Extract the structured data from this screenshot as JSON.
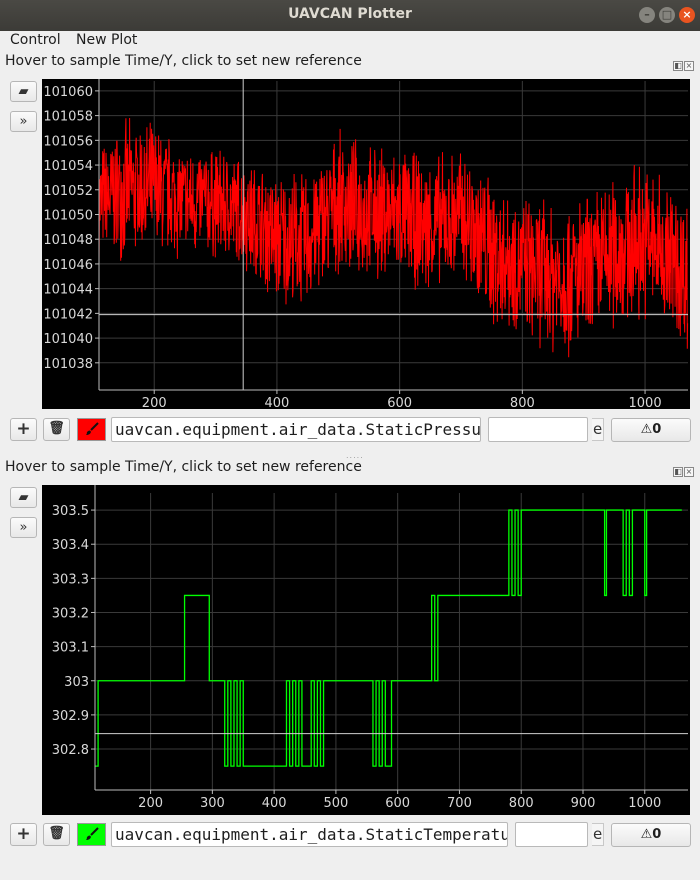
{
  "window": {
    "title": "UAVCAN Plotter"
  },
  "menu": {
    "items": [
      "Control",
      "New Plot"
    ]
  },
  "plots": [
    {
      "header": "Hover to sample Time/Y, click to set new reference",
      "topic": "uavcan.equipment.air_data.StaticPressure",
      "expression_value": "",
      "expression_tail": "e",
      "warning_count": "0",
      "color": "#ff0000",
      "crosshair": {
        "x": 345,
        "y": 101041.9
      }
    },
    {
      "header": "Hover to sample Time/Y, click to set new reference",
      "topic": "uavcan.equipment.air_data.StaticTemperature",
      "expression_value": "",
      "expression_tail": "e",
      "warning_count": "0",
      "color": "#00ff00",
      "crosshair": {
        "y": 302.845
      }
    }
  ],
  "chart_data": [
    {
      "type": "line",
      "series": [
        {
          "name": "uavcan.equipment.air_data.StaticPressure",
          "color": "#ff0000",
          "x": [
            110,
            150,
            200,
            250,
            300,
            350,
            400,
            450,
            500,
            550,
            600,
            650,
            700,
            750,
            800,
            850,
            900,
            950,
            1000,
            1050,
            1070
          ],
          "center": [
            101051,
            101052,
            101052,
            101051,
            101051,
            101050,
            101048,
            101048,
            101051,
            101050,
            101050,
            101049,
            101050,
            101047,
            101046,
            101045,
            101045,
            101047,
            101048,
            101046,
            101045
          ],
          "spread": [
            5,
            6,
            6,
            5,
            5,
            5,
            6,
            6,
            6,
            6,
            6,
            6,
            6,
            7,
            6,
            7,
            7,
            7,
            7,
            7,
            7
          ]
        }
      ],
      "xlim": [
        110,
        1070
      ],
      "ylim": [
        101035.8,
        101060.8
      ],
      "xticks": [
        200,
        400,
        600,
        800,
        1000
      ],
      "yticks": [
        101038,
        101040,
        101042,
        101044,
        101046,
        101048,
        101050,
        101052,
        101054,
        101056,
        101058,
        101060
      ],
      "grid": true
    },
    {
      "type": "line",
      "series": [
        {
          "name": "uavcan.equipment.air_data.StaticTemperature",
          "color": "#00ff00",
          "steps": [
            [
              110,
              302.75
            ],
            [
              115,
              303.0
            ],
            [
              255,
              303.25
            ],
            [
              295,
              303.0
            ],
            [
              320,
              302.75
            ],
            [
              325,
              303.0
            ],
            [
              330,
              302.75
            ],
            [
              335,
              303.0
            ],
            [
              340,
              302.75
            ],
            [
              345,
              303.0
            ],
            [
              350,
              302.75
            ],
            [
              420,
              303.0
            ],
            [
              425,
              302.75
            ],
            [
              430,
              303.0
            ],
            [
              435,
              302.75
            ],
            [
              440,
              303.0
            ],
            [
              445,
              302.75
            ],
            [
              460,
              303.0
            ],
            [
              465,
              302.75
            ],
            [
              470,
              303.0
            ],
            [
              475,
              302.75
            ],
            [
              480,
              303.0
            ],
            [
              560,
              302.75
            ],
            [
              565,
              303.0
            ],
            [
              570,
              302.75
            ],
            [
              575,
              303.0
            ],
            [
              580,
              302.75
            ],
            [
              590,
              303.0
            ],
            [
              655,
              303.25
            ],
            [
              660,
              303.0
            ],
            [
              665,
              303.25
            ],
            [
              780,
              303.5
            ],
            [
              785,
              303.25
            ],
            [
              790,
              303.5
            ],
            [
              795,
              303.25
            ],
            [
              800,
              303.5
            ],
            [
              935,
              303.25
            ],
            [
              938,
              303.5
            ],
            [
              965,
              303.25
            ],
            [
              970,
              303.5
            ],
            [
              975,
              303.25
            ],
            [
              980,
              303.5
            ],
            [
              1000,
              303.25
            ],
            [
              1003,
              303.5
            ],
            [
              1060,
              303.5
            ]
          ]
        }
      ],
      "xlim": [
        110,
        1070
      ],
      "ylim": [
        302.68,
        303.55
      ],
      "xticks": [
        200,
        300,
        400,
        500,
        600,
        700,
        800,
        900,
        1000
      ],
      "yticks": [
        302.8,
        302.9,
        303,
        303.1,
        303.2,
        303.3,
        303.4,
        303.5
      ],
      "ytick_labels": [
        "302.8",
        "302.9",
        "303",
        "303.1",
        "303.2",
        "303.3",
        "303.4",
        "303.5"
      ],
      "grid": true
    }
  ]
}
